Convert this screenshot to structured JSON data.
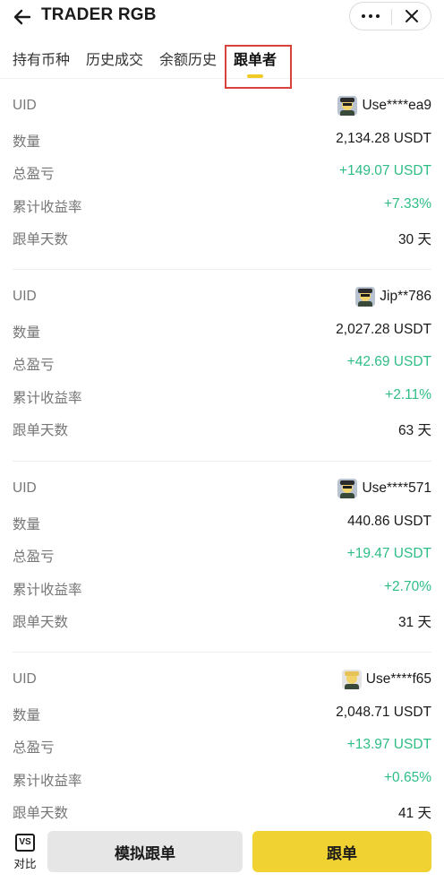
{
  "header": {
    "title": "TRADER RGB"
  },
  "tabs": [
    {
      "label": "持有币种",
      "active": false
    },
    {
      "label": "历史成交",
      "active": false
    },
    {
      "label": "余额历史",
      "active": false
    },
    {
      "label": "跟单者",
      "active": true
    }
  ],
  "labels": {
    "uid": "UID",
    "amount": "数量",
    "pnl": "总盈亏",
    "roi": "累计收益率",
    "days": "跟单天数"
  },
  "followers": [
    {
      "uid": "Use****ea9",
      "amount": "2,134.28 USDT",
      "pnl": "+149.07 USDT",
      "roi": "+7.33%",
      "days": "30 天"
    },
    {
      "uid": "Jip**786",
      "amount": "2,027.28 USDT",
      "pnl": "+42.69 USDT",
      "roi": "+2.11%",
      "days": "63 天"
    },
    {
      "uid": "Use****571",
      "amount": "440.86 USDT",
      "pnl": "+19.47 USDT",
      "roi": "+2.70%",
      "days": "31 天"
    },
    {
      "uid": "Use****f65",
      "amount": "2,048.71 USDT",
      "pnl": "+13.97 USDT",
      "roi": "+0.65%",
      "days": "41 天"
    }
  ],
  "bottom": {
    "compare_icon": "VS",
    "compare_label": "对比",
    "simulate_label": "模拟跟单",
    "follow_label": "跟单"
  },
  "colors": {
    "positive": "#2ebd85",
    "accent": "#f0d232",
    "highlight_box": "#d9413b"
  }
}
